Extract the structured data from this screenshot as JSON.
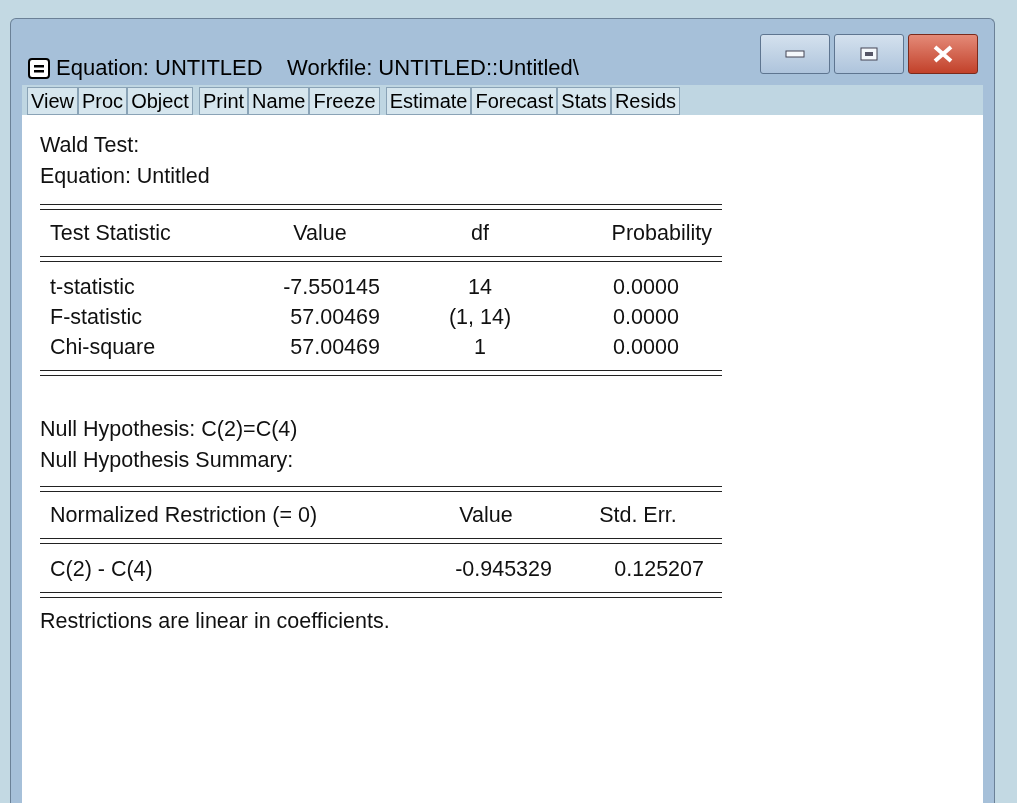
{
  "window": {
    "title": "Equation: UNTITLED    Workfile: UNTITLED::Untitled\\"
  },
  "toolbar": [
    [
      "View",
      "Proc",
      "Object"
    ],
    [
      "Print",
      "Name",
      "Freeze"
    ],
    [
      "Estimate",
      "Forecast",
      "Stats",
      "Resids"
    ]
  ],
  "output": {
    "heading": [
      "Wald Test:",
      "Equation: Untitled"
    ],
    "test_table": {
      "columns": [
        "Test Statistic",
        "Value",
        "df",
        "Probability"
      ],
      "rows": [
        [
          "t-statistic",
          "-7.550145",
          "14",
          "0.0000"
        ],
        [
          "F-statistic",
          "57.00469",
          "(1, 14)",
          "0.0000"
        ],
        [
          "Chi-square",
          "57.00469",
          "1",
          "0.0000"
        ]
      ]
    },
    "hypothesis": [
      "Null Hypothesis: C(2)=C(4)",
      "Null Hypothesis Summary:"
    ],
    "restriction_table": {
      "columns": [
        "Normalized Restriction (= 0)",
        "Value",
        "Std. Err."
      ],
      "rows": [
        [
          "C(2) - C(4)",
          "-0.945329",
          "0.125207"
        ]
      ]
    },
    "note": "Restrictions are linear in coefficients."
  }
}
